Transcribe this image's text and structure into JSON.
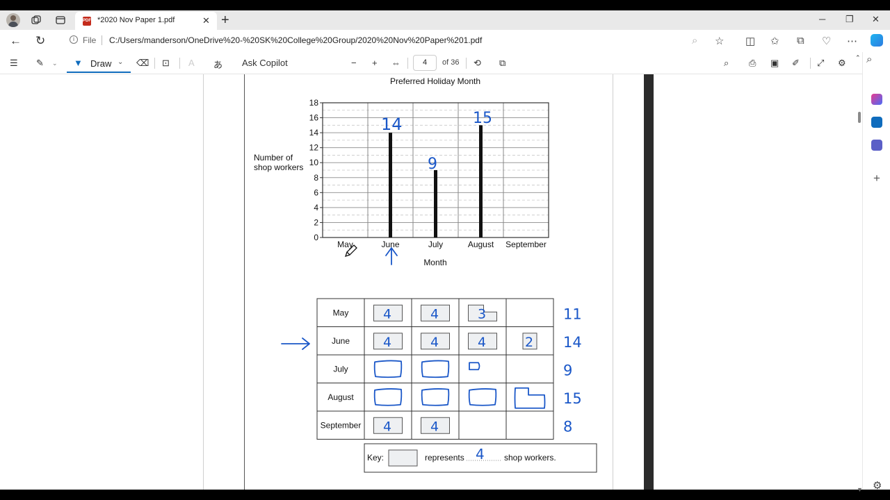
{
  "tab": {
    "title": "*2020 Nov Paper 1.pdf"
  },
  "address": {
    "scheme_label": "File",
    "url": "C:/Users/manderson/OneDrive%20-%20SK%20College%20Group/2020%20Nov%20Paper%201.pdf"
  },
  "toolbar": {
    "draw_label": "Draw",
    "copilot_label": "Ask Copilot",
    "page_current": "4",
    "page_total": "of 36"
  },
  "chart_data": {
    "type": "bar",
    "title": "Preferred Holiday Month",
    "xlabel": "Month",
    "ylabel": "Number of shop workers",
    "ylim": [
      0,
      18
    ],
    "yticks": [
      "0",
      "2",
      "4",
      "6",
      "8",
      "10",
      "12",
      "14",
      "16",
      "18"
    ],
    "categories": [
      "May",
      "June",
      "July",
      "August",
      "September"
    ],
    "values": [
      null,
      14,
      9,
      15,
      null
    ],
    "annotations": [
      "14",
      "9",
      "15"
    ]
  },
  "pictogram": {
    "rows": [
      {
        "month": "May",
        "symbols": [
          "4",
          "4",
          "3"
        ],
        "total": "11"
      },
      {
        "month": "June",
        "symbols": [
          "4",
          "4",
          "4",
          "2"
        ],
        "total": "14"
      },
      {
        "month": "July",
        "symbols": [],
        "total": "9"
      },
      {
        "month": "August",
        "symbols": [],
        "total": "15"
      },
      {
        "month": "September",
        "symbols": [
          "4",
          "4"
        ],
        "total": "8"
      }
    ],
    "key_label": "Key:",
    "key_represents": "represents",
    "key_value": "4",
    "key_unit": "shop workers."
  }
}
